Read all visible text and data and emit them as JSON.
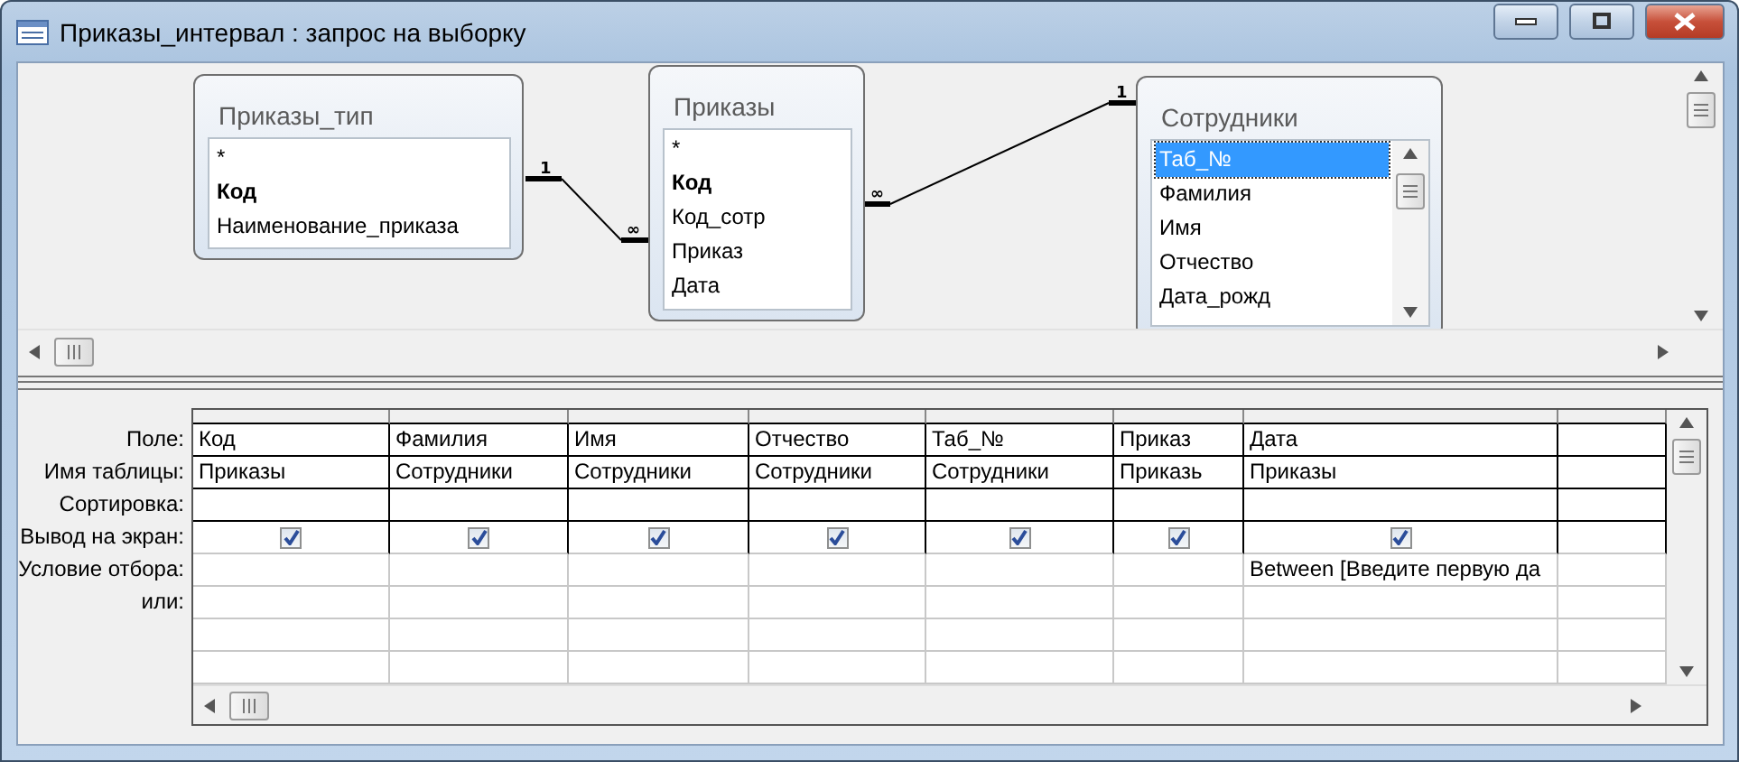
{
  "window": {
    "title": "Приказы_интервал : запрос на выборку"
  },
  "tables": [
    {
      "title": "Приказы_тип",
      "scrollable": false,
      "fields": [
        {
          "name": "*",
          "bold": false,
          "selected": false
        },
        {
          "name": "Код",
          "bold": true,
          "selected": false
        },
        {
          "name": "Наименование_приказа",
          "bold": false,
          "selected": false
        }
      ]
    },
    {
      "title": "Приказы",
      "scrollable": false,
      "fields": [
        {
          "name": "*",
          "bold": false,
          "selected": false
        },
        {
          "name": "Код",
          "bold": true,
          "selected": false
        },
        {
          "name": "Код_сотр",
          "bold": false,
          "selected": false
        },
        {
          "name": "Приказ",
          "bold": false,
          "selected": false
        },
        {
          "name": "Дата",
          "bold": false,
          "selected": false
        }
      ]
    },
    {
      "title": "Сотрудники",
      "scrollable": true,
      "fields": [
        {
          "name": "Таб_№",
          "bold": false,
          "selected": true
        },
        {
          "name": "Фамилия",
          "bold": false,
          "selected": false
        },
        {
          "name": "Имя",
          "bold": false,
          "selected": false
        },
        {
          "name": "Отчество",
          "bold": false,
          "selected": false
        },
        {
          "name": "Дата_рожд",
          "bold": false,
          "selected": false
        }
      ]
    }
  ],
  "relations": [
    {
      "one": "1",
      "many": "∞"
    },
    {
      "one": "1",
      "many": "∞"
    }
  ],
  "grid": {
    "row_labels": [
      "Поле:",
      "Имя таблицы:",
      "Сортировка:",
      "Вывод на экран:",
      "Условие отбора:",
      "или:"
    ],
    "columns": [
      {
        "field": "Код",
        "table": "Приказы",
        "show": true
      },
      {
        "field": "Фамилия",
        "table": "Сотрудники",
        "show": true
      },
      {
        "field": "Имя",
        "table": "Сотрудники",
        "show": true
      },
      {
        "field": "Отчество",
        "table": "Сотрудники",
        "show": true
      },
      {
        "field": "Таб_№",
        "table": "Сотрудники",
        "show": true
      },
      {
        "field": "Приказ",
        "table": "Приказь",
        "show": true
      },
      {
        "field": "Дата",
        "table": "Приказы",
        "show": true,
        "criteria": "Between [Введите первую да"
      }
    ]
  }
}
